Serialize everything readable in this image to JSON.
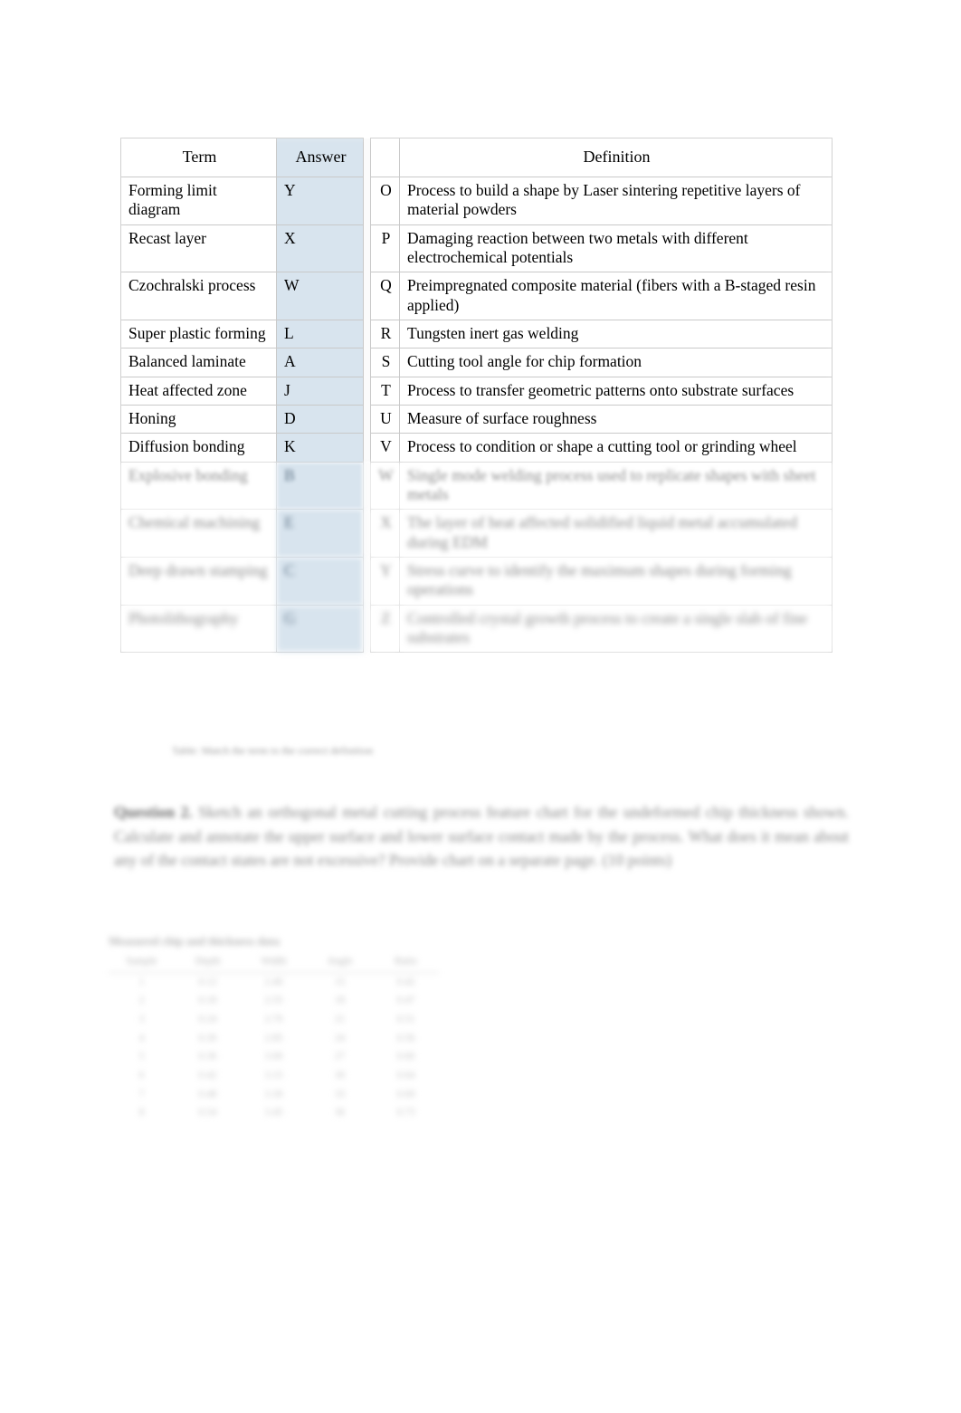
{
  "document": {
    "type": "worksheet",
    "page_background": "#ffffff"
  },
  "match_table": {
    "headers": {
      "term": "Term",
      "answer": "Answer",
      "gap": "",
      "letter": "",
      "definition": "Definition"
    },
    "answer_cell_color": "#d8e4ee",
    "border_color": "#c9c9c9",
    "rows": [
      {
        "term": "Forming limit diagram",
        "answer": "Y",
        "letter": "O",
        "definition": "Process to build a shape by Laser sintering repetitive layers of material powders",
        "legible": true
      },
      {
        "term": "Recast layer",
        "answer": "X",
        "letter": "P",
        "definition": "Damaging reaction between two metals with different electrochemical potentials",
        "legible": true
      },
      {
        "term": "Czochralski process",
        "answer": "W",
        "letter": "Q",
        "definition": "Preimpregnated composite material (fibers with a B-staged resin applied)",
        "legible": true
      },
      {
        "term": "Super plastic forming",
        "answer": "L",
        "letter": "R",
        "definition": "Tungsten inert gas welding",
        "legible": true
      },
      {
        "term": "Balanced laminate",
        "answer": "A",
        "letter": "S",
        "definition": "Cutting tool angle for chip formation",
        "legible": true
      },
      {
        "term": "Heat affected zone",
        "answer": "J",
        "letter": "T",
        "definition": "Process to transfer geometric patterns onto substrate surfaces",
        "legible": true
      },
      {
        "term": "Honing",
        "answer": "D",
        "letter": "U",
        "definition": "Measure of surface roughness",
        "legible": true
      },
      {
        "term": "Diffusion bonding",
        "answer": "K",
        "letter": "V",
        "definition": "Process to condition or shape a cutting tool or grinding wheel",
        "legible": true
      },
      {
        "term": "Explosive bonding",
        "answer": "B",
        "letter": "W",
        "definition": "Single mode welding process used to replicate shapes with sheet metals",
        "legible": false
      },
      {
        "term": "Chemical machining",
        "answer": "E",
        "letter": "X",
        "definition": "The layer of heat affected solidified liquid metal accumulated during EDM",
        "legible": false
      },
      {
        "term": "Deep drawn stamping",
        "answer": "C",
        "letter": "Y",
        "definition": "Stress curve to identify the maximum shapes during forming operations",
        "legible": false
      },
      {
        "term": "Photolithography",
        "answer": "G",
        "letter": "Z",
        "definition": "Controlled crystal growth process to create a single slab of fine substrates",
        "legible": false
      }
    ],
    "caption": "Table: Match the term to the correct definition"
  },
  "question_paragraph": {
    "lead_bold": "Question 2.",
    "text": "Sketch an orthogonal metal cutting process feature chart for the undeformed chip thickness shown. Calculate and annotate the upper surface and lower surface contact made by the process. What does it mean about any of the contact states are not excessive? Provide chart on a separate page. (10 points)"
  },
  "bottom_table": {
    "title": "Measured chip and thickness data",
    "headers": [
      "Sample",
      "Depth",
      "Width",
      "Angle",
      "Ratio"
    ],
    "rows": [
      [
        "1",
        "0.12",
        "2.40",
        "15",
        "0.42"
      ],
      [
        "2",
        "0.18",
        "2.55",
        "18",
        "0.47"
      ],
      [
        "3",
        "0.24",
        "2.70",
        "21",
        "0.51"
      ],
      [
        "4",
        "0.30",
        "2.85",
        "24",
        "0.56"
      ],
      [
        "5",
        "0.36",
        "3.00",
        "27",
        "0.60"
      ],
      [
        "6",
        "0.42",
        "3.15",
        "30",
        "0.64"
      ],
      [
        "7",
        "0.48",
        "3.30",
        "33",
        "0.69"
      ],
      [
        "8",
        "0.54",
        "3.45",
        "36",
        "0.73"
      ]
    ]
  }
}
